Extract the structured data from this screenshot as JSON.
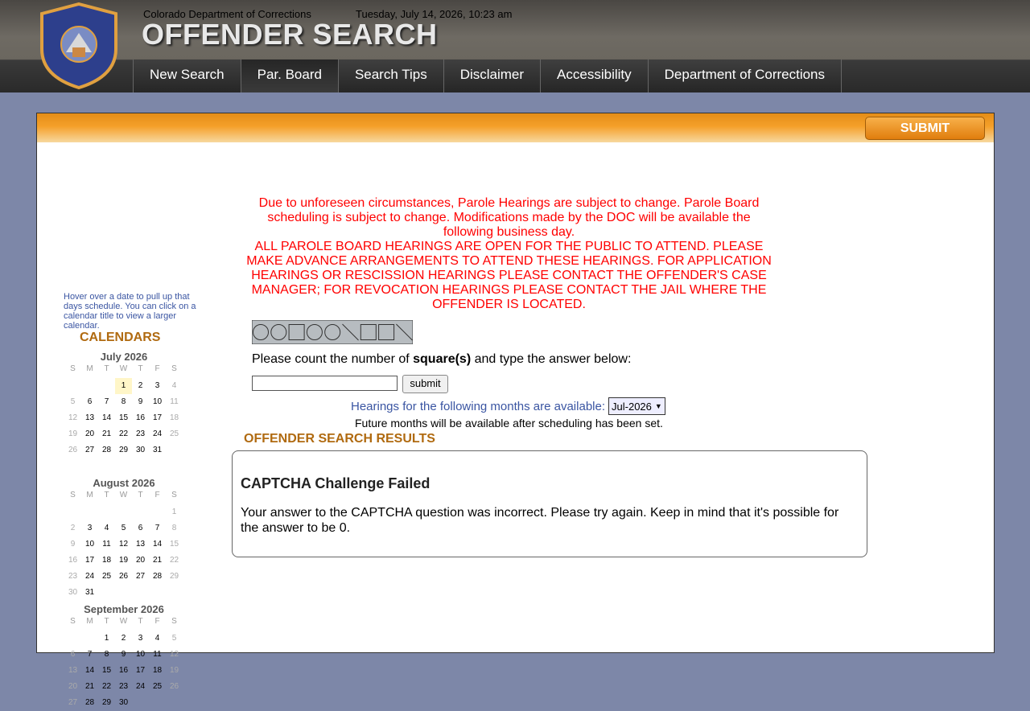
{
  "header": {
    "org": "Colorado Department of Corrections",
    "datetime": "Tuesday, July 14, 2026, 10:23 am",
    "title": "OFFENDER SEARCH",
    "logo_text": "COLORADO DEPARTMENT OF CORRECTIONS"
  },
  "nav": {
    "items": [
      "New Search",
      "Par. Board",
      "Search Tips",
      "Disclaimer",
      "Accessibility",
      "Department of Corrections"
    ],
    "active": "Par. Board"
  },
  "toolbar": {
    "submit_label": "SUBMIT"
  },
  "sidebar": {
    "hint": "Hover over a date to pull up that days schedule. You can click on a calendar title to view a larger calendar.",
    "heading": "CALENDARS",
    "weekday_labels": [
      "S",
      "M",
      "T",
      "W",
      "T",
      "F",
      "S"
    ],
    "calendars": [
      {
        "title": "July 2026",
        "first_weekday": 3,
        "days": 31,
        "highlight": 1
      },
      {
        "title": "August 2026",
        "first_weekday": 6,
        "days": 31
      },
      {
        "title": "September 2026",
        "first_weekday": 2,
        "days": 30
      }
    ]
  },
  "main": {
    "notice_1": "Due to unforeseen circumstances, Parole Hearings are subject to change. Parole Board scheduling is subject to change. Modifications made by the DOC will be available the following business day.",
    "notice_2": "ALL PAROLE BOARD HEARINGS ARE OPEN FOR THE PUBLIC TO ATTEND. PLEASE MAKE ADVANCE ARRANGEMENTS TO ATTEND THESE HEARINGS. FOR APPLICATION HEARINGS OR RESCISSION HEARINGS PLEASE CONTACT THE OFFENDER'S CASE MANAGER; FOR REVOCATION HEARINGS PLEASE CONTACT THE JAIL WHERE THE OFFENDER IS LOCATED.",
    "captcha_prompt_before": "Please count the number of ",
    "captcha_prompt_bold": "square(s)",
    "captcha_prompt_after": " and type the answer below:",
    "captcha_value": "",
    "captcha_submit": "submit",
    "captcha_shapes": [
      "circle",
      "circle",
      "square",
      "circle",
      "circle",
      "line",
      "square",
      "square",
      "line"
    ],
    "months_label": "Hearings for the following months are available:",
    "months_selected": "Jul-2026",
    "future_note": "Future months will be available after scheduling has been set.",
    "results_heading": "OFFENDER SEARCH RESULTS",
    "result_title": "CAPTCHA Challenge Failed",
    "result_message": "Your answer to the CAPTCHA question was incorrect. Please try again. Keep in mind that it's possible for the answer to be 0."
  }
}
